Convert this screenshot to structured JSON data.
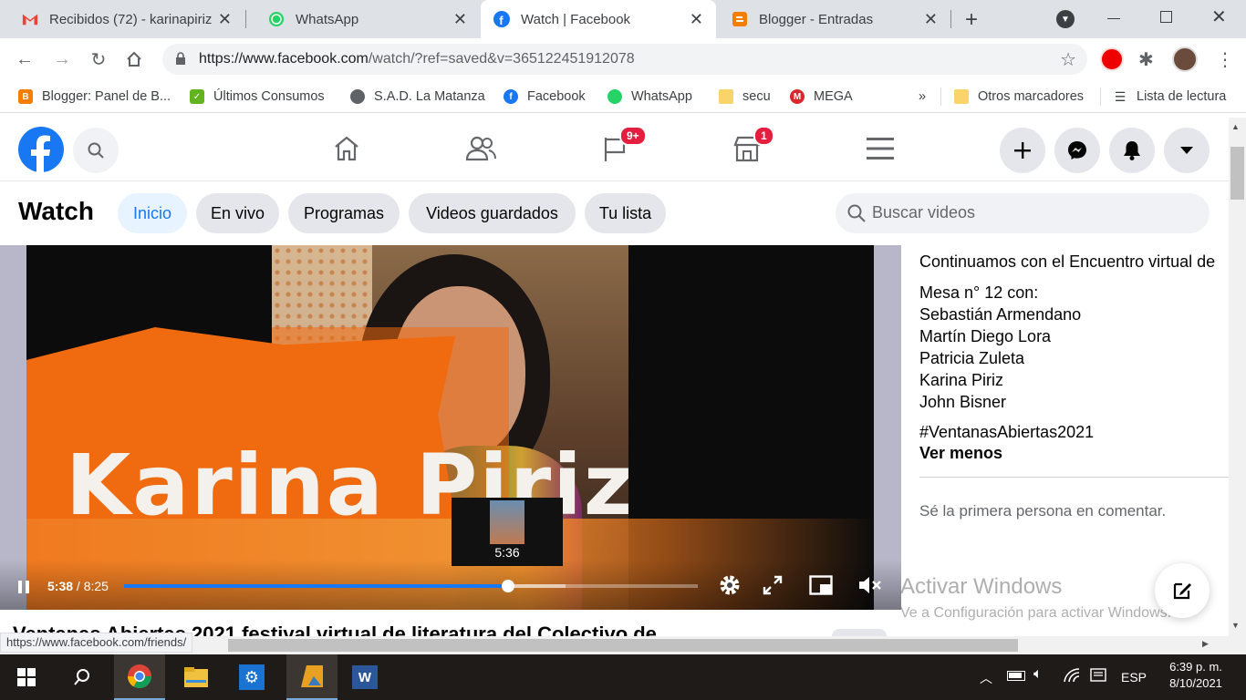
{
  "browser": {
    "tabs": [
      {
        "label": "Recibidos (72) - karinapiriz",
        "icon": "gmail-icon"
      },
      {
        "label": "WhatsApp",
        "icon": "whatsapp-icon"
      },
      {
        "label": "Watch | Facebook",
        "icon": "facebook-icon",
        "active": true
      },
      {
        "label": "Blogger - Entradas",
        "icon": "blogger-icon"
      }
    ],
    "url_host": "https://www.facebook.com",
    "url_path": "/watch/?ref=saved&v=365122451912078",
    "bookmarks": [
      {
        "label": "Blogger: Panel de B...",
        "icon": "blogger-icon"
      },
      {
        "label": "Últimos Consumos",
        "icon": "consumos-icon"
      },
      {
        "label": "S.A.D. La Matanza",
        "icon": "globe-icon"
      },
      {
        "label": "Facebook",
        "icon": "facebook-icon"
      },
      {
        "label": "WhatsApp",
        "icon": "whatsapp-icon"
      },
      {
        "label": "secu",
        "icon": "folder-icon"
      },
      {
        "label": "MEGA",
        "icon": "mega-icon"
      }
    ],
    "bookmarks_overflow": "»",
    "other_bookmarks": "Otros marcadores",
    "reading_list": "Lista de lectura",
    "status_url": "https://www.facebook.com/friends/"
  },
  "fb": {
    "groups_badge": "9+",
    "marketplace_badge": "1",
    "watch_title": "Watch",
    "tabs": [
      "Inicio",
      "En vivo",
      "Programas",
      "Videos guardados",
      "Tu lista"
    ],
    "search_placeholder": "Buscar videos"
  },
  "video": {
    "overlay_name": "Karina Piriz",
    "current_time": "5:38",
    "duration": "8:25",
    "time_sep": " / ",
    "hover_time": "5:36",
    "progress": 0.669,
    "buffered": 0.77,
    "title_partial": "Ventanas Abiertas 2021 festival virtual de literatura del Colectivo de"
  },
  "description": {
    "intro": "Continuamos con el Encuentro virtual de",
    "mesa": "Mesa n° 12 con:",
    "participants": [
      "Sebastián Armendano",
      "Martín Diego Lora",
      "Patricia Zuleta",
      "Karina Piriz",
      "John Bisner"
    ],
    "hashtag": "#VentanasAbiertas2021",
    "see_less": "Ver menos",
    "comment_prompt": "Sé la primera persona en comentar."
  },
  "watermark": {
    "title": "Activar Windows",
    "subtitle": "Ve a Configuración para activar Windows."
  },
  "taskbar": {
    "language": "ESP",
    "time": "6:39 p. m.",
    "date": "8/10/2021"
  }
}
